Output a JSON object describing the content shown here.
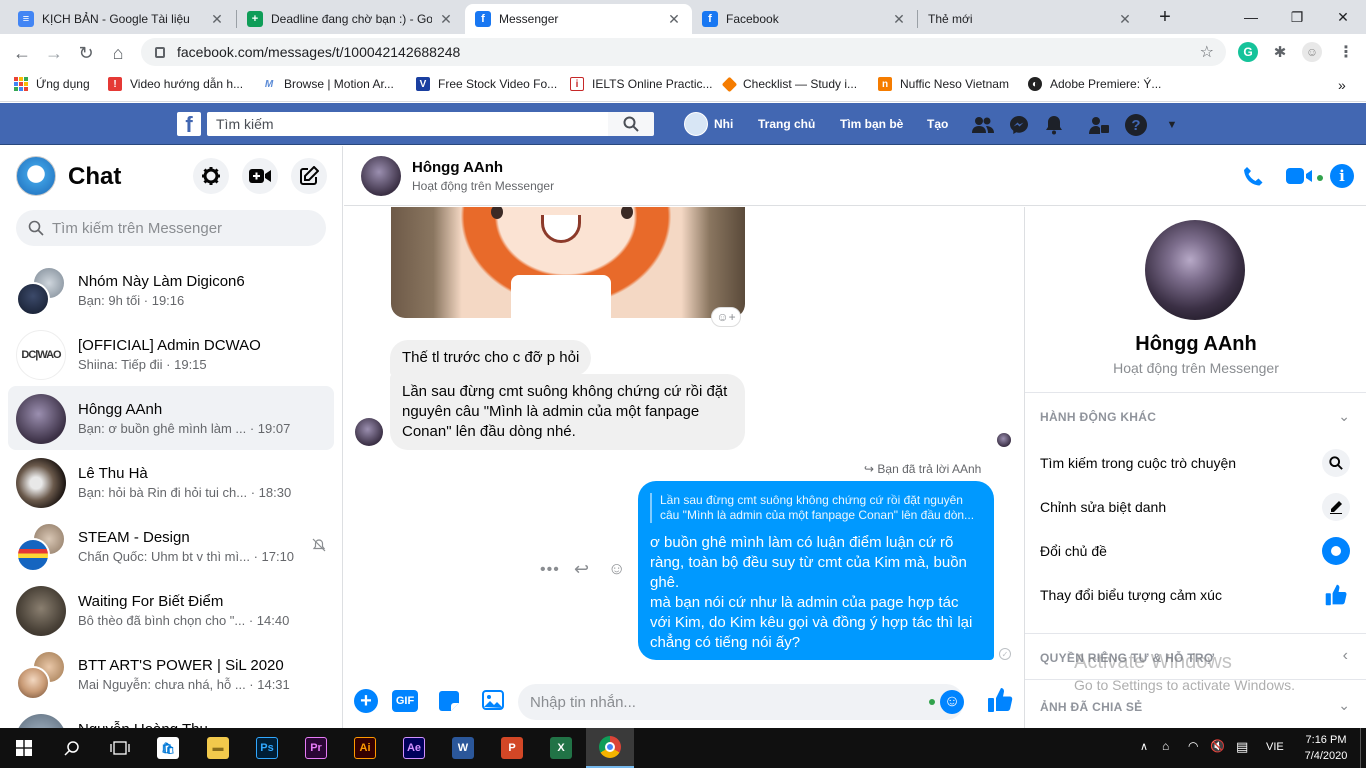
{
  "browser": {
    "tabs": [
      {
        "title": "KỊCH BẢN - Google Tài liệu",
        "icon": "docs-icon",
        "active": false
      },
      {
        "title": "Deadline đang chờ bạn :) - Goo",
        "icon": "sheets-icon",
        "active": false
      },
      {
        "title": "Messenger",
        "icon": "facebook-icon",
        "active": true
      },
      {
        "title": "Facebook",
        "icon": "facebook-icon",
        "active": false
      },
      {
        "title": "Thẻ mới",
        "icon": "",
        "active": false
      }
    ],
    "url": "facebook.com/messages/t/100042142688248",
    "bookmarks": [
      {
        "label": "Ứng dụng"
      },
      {
        "label": "Video hướng dẫn h..."
      },
      {
        "label": "Browse | Motion Ar..."
      },
      {
        "label": "Free Stock Video Fo..."
      },
      {
        "label": "IELTS Online Practic..."
      },
      {
        "label": "Checklist — Study i..."
      },
      {
        "label": "Nuffic Neso Vietnam"
      },
      {
        "label": "Adobe Premiere: Ý..."
      }
    ]
  },
  "fbbar": {
    "search_placeholder": "Tìm kiếm",
    "user_name": "Nhi",
    "home": "Trang chủ",
    "find_friends": "Tìm bạn bè",
    "create": "Tạo"
  },
  "sidebar": {
    "title": "Chat",
    "search_placeholder": "Tìm kiếm trên Messenger",
    "conversations": [
      {
        "name": "Nhóm Này Làm Digicon6",
        "snippet": "Bạn: 9h tối · 19:16"
      },
      {
        "name": "[OFFICIAL] Admin DCWAO",
        "snippet": "Shiina: Tiếp đii · 19:15"
      },
      {
        "name": "Hôngg AAnh",
        "snippet": "Bạn: ơ buồn ghê mình làm ... · 19:07"
      },
      {
        "name": "Lê Thu Hà",
        "snippet": "Bạn: hỏi bà Rin đi hỏi tui ch... · 18:30"
      },
      {
        "name": "STEAM - Design",
        "snippet": "Chấn Quốc: Uhm bt v thì mì... · 17:10"
      },
      {
        "name": "Waiting For Biết Điểm",
        "snippet": "Bô thèo đã bình chọn cho \"... · 14:40"
      },
      {
        "name": "BTT ART'S POWER | SiL 2020",
        "snippet": "Mai Nguyễn: chưa nhá, hỗ ... · 14:31"
      },
      {
        "name": "Nguyễn Hoàng Thu",
        "snippet": ""
      }
    ]
  },
  "conversation": {
    "name": "Hôngg AAnh",
    "status": "Hoạt động trên Messenger",
    "messages": {
      "m1": "Thế tl trước cho c đỡ p hỏi",
      "m2": "Lần sau đừng cmt suông không chứng cứ rồi đặt nguyên câu \"Mình là admin của một fanpage Conan\" lên đầu dòng nhé.",
      "reply_label": "Bạn đã trả lời AAnh",
      "quote": "Lần sau đừng cmt suông không chứng cứ rồi đặt nguyên câu \"Mình là admin của một fanpage Conan\" lên đầu dòn...",
      "m3": "ơ buồn ghê mình làm có luận điểm luận cứ rõ ràng, toàn bộ đều suy từ cmt của Kim mà, buồn ghê.\nmà bạn nói cứ như là admin của page hợp tác với Kim, do Kim kêu gọi và đồng ý hợp tác thì lại chẳng có tiếng nói ấy?"
    },
    "composer_placeholder": "Nhập tin nhắn..."
  },
  "info": {
    "name": "Hôngg AAnh",
    "status": "Hoạt động trên Messenger",
    "section_actions": "HÀNH ĐỘNG KHÁC",
    "actions": [
      {
        "label": "Tìm kiếm trong cuộc trò chuyện"
      },
      {
        "label": "Chỉnh sửa biệt danh"
      },
      {
        "label": "Đổi chủ đề"
      },
      {
        "label": "Thay đổi biểu tượng cảm xúc"
      }
    ],
    "section_privacy": "QUYỀN RIÊNG TƯ & HỖ TRỢ",
    "section_media": "ẢNH ĐÃ CHIA SẺ",
    "watermark_title": "Activate Windows",
    "watermark_sub": "Go to Settings to activate Windows."
  },
  "taskbar": {
    "lang": "VIE",
    "time": "7:16 PM",
    "date": "7/4/2020"
  },
  "colors": {
    "fb_blue": "#4267b2",
    "messenger_blue": "#0099ff",
    "accent": "#0084ff"
  }
}
